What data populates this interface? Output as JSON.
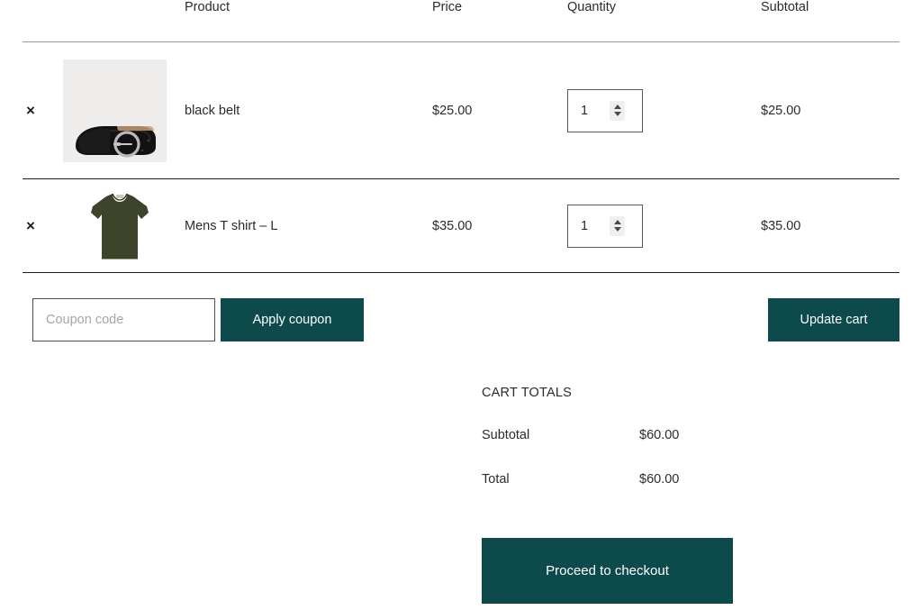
{
  "table": {
    "headers": {
      "remove": "",
      "thumbnail": "",
      "product": "Product",
      "price": "Price",
      "quantity": "Quantity",
      "subtotal": "Subtotal"
    },
    "rows": [
      {
        "remove_label": "×",
        "thumb_name": "black-belt-thumbnail",
        "name": "black belt",
        "price": "$25.00",
        "quantity": "1",
        "subtotal": "$25.00"
      },
      {
        "remove_label": "×",
        "thumb_name": "mens-t-shirt-thumbnail",
        "name": "Mens T shirt – L",
        "price": "$35.00",
        "quantity": "1",
        "subtotal": "$35.00"
      }
    ]
  },
  "coupon": {
    "placeholder": "Coupon code",
    "value": "",
    "apply_label": "Apply coupon"
  },
  "actions": {
    "update_cart_label": "Update cart"
  },
  "totals": {
    "title": "CART TOTALS",
    "lines": [
      {
        "label": "Subtotal",
        "value": "$60.00"
      },
      {
        "label": "Total",
        "value": "$60.00"
      }
    ],
    "checkout_label": "Proceed to checkout"
  },
  "colors": {
    "accent": "#0c4a4c",
    "text": "#2b2b2b",
    "placeholder": "#a6a6a6",
    "row_border": "#1f1f1f",
    "head_border": "#9a9a9a",
    "belt_bg": "#efedeb",
    "shirt_green": "#3d4429"
  }
}
